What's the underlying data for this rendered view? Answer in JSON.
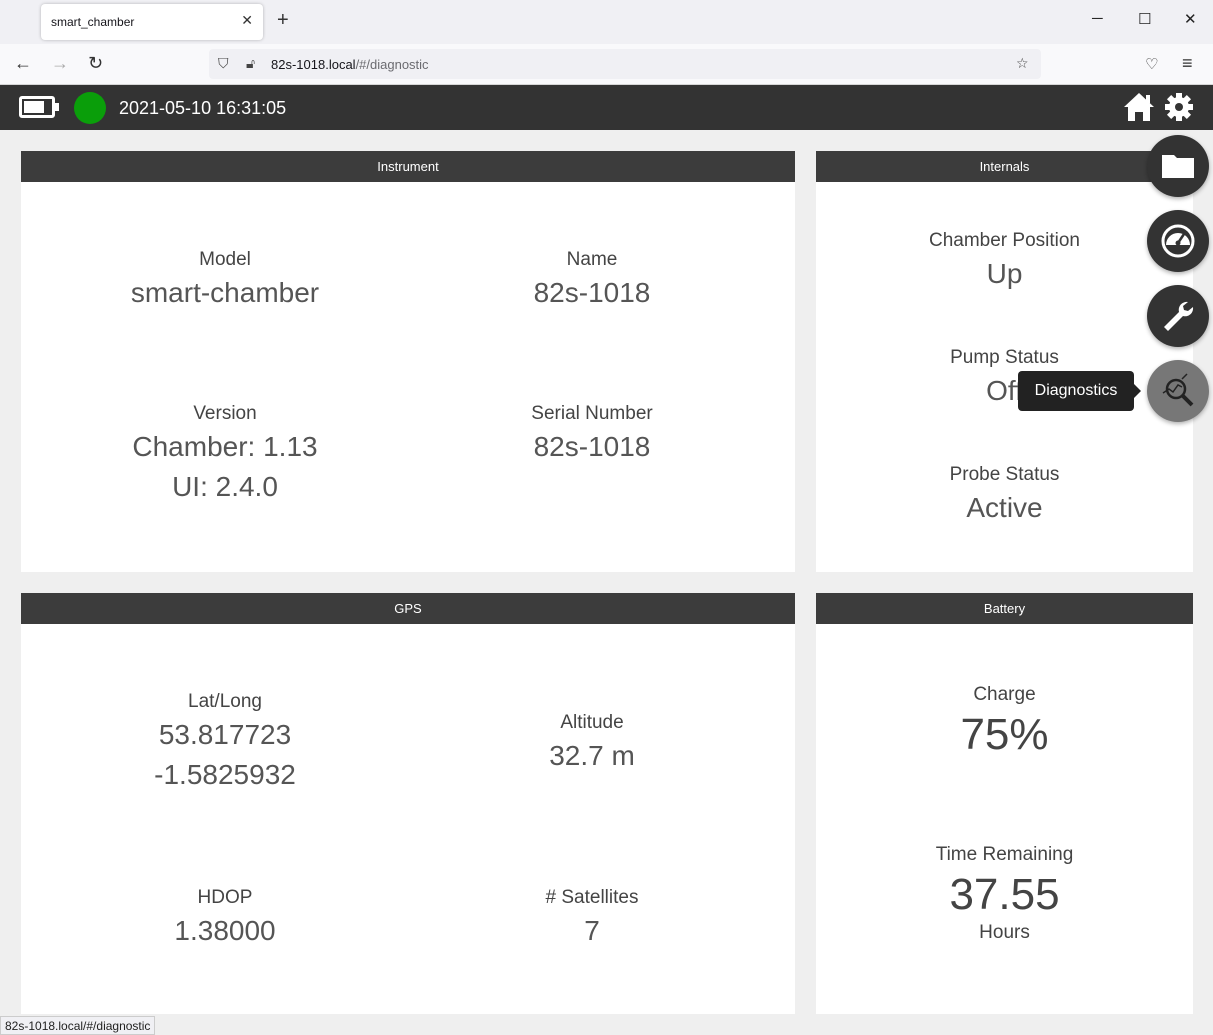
{
  "browser": {
    "tab_title": "smart_chamber",
    "tab_close": "✕",
    "new_tab": "+",
    "url_host": "82s-1018.local",
    "url_path": "/#/diagnostic",
    "status_url": "82s-1018.local/#/diagnostic",
    "window_controls": {
      "minimize": "─",
      "maximize": "☐",
      "close": "✕"
    }
  },
  "app": {
    "datetime": "2021-05-10 16:31:05",
    "battery_level": 0.75,
    "status_color": "#0a9e0a"
  },
  "instrument": {
    "title": "Instrument",
    "model_label": "Model",
    "model_value": "smart-chamber",
    "name_label": "Name",
    "name_value": "82s-1018",
    "version_label": "Version",
    "version_chamber": "Chamber: 1.13",
    "version_ui": "UI: 2.4.0",
    "serial_label": "Serial Number",
    "serial_value": "82s-1018"
  },
  "internals": {
    "title": "Internals",
    "chamber_label": "Chamber Position",
    "chamber_value": "Up",
    "pump_label": "Pump Status",
    "pump_value": "Off",
    "probe_label": "Probe Status",
    "probe_value": "Active"
  },
  "gps": {
    "title": "GPS",
    "latlong_label": "Lat/Long",
    "lat_value": "53.817723",
    "long_value": "-1.5825932",
    "altitude_label": "Altitude",
    "altitude_value": "32.7 m",
    "hdop_label": "HDOP",
    "hdop_value": "1.38000",
    "sat_label": "# Satellites",
    "sat_value": "7"
  },
  "battery": {
    "title": "Battery",
    "charge_label": "Charge",
    "charge_value": "75%",
    "time_label": "Time Remaining",
    "time_value": "37.55",
    "time_unit": "Hours"
  },
  "fab": {
    "tooltip": "Diagnostics",
    "icons": [
      "folder-icon",
      "gauge-icon",
      "wrench-icon",
      "diagnostics-icon"
    ]
  }
}
